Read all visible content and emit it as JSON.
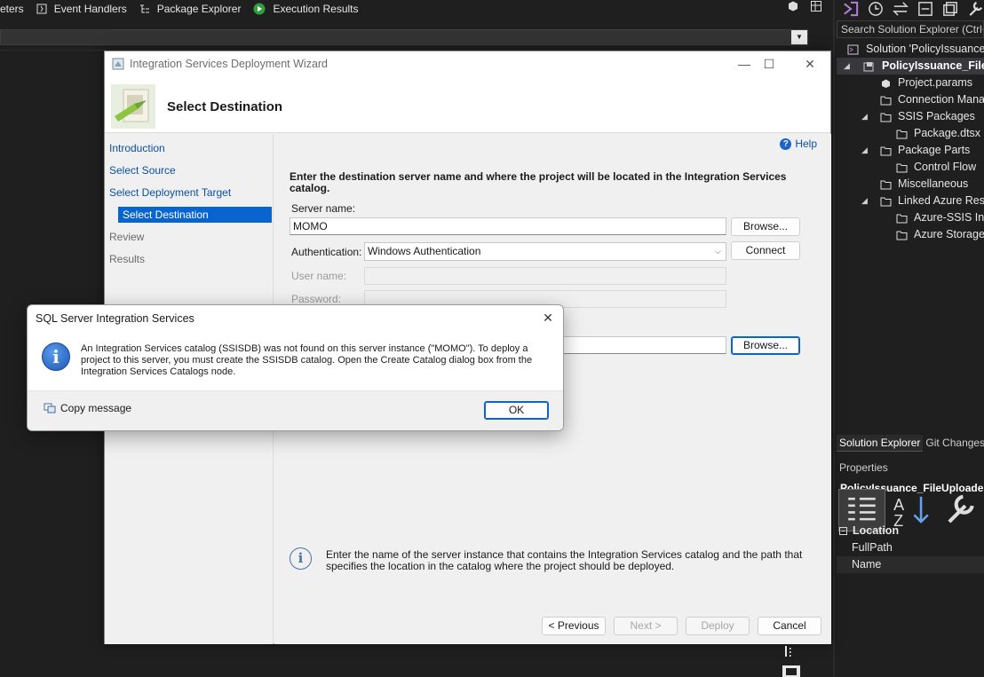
{
  "vs": {
    "toolbar": {
      "items": [
        {
          "label": "eters"
        },
        {
          "label": "Event Handlers"
        },
        {
          "label": "Package Explorer"
        },
        {
          "label": "Execution Results"
        }
      ]
    }
  },
  "solution_explorer": {
    "search_placeholder": "Search Solution Explorer (Ctrl+;)",
    "tree": [
      {
        "label": "Solution 'PolicyIssuance_FileUploader'",
        "depth": 0,
        "arrow": "",
        "icon": "solution-icon"
      },
      {
        "label": "PolicyIssuance_FileUploader",
        "depth": 0,
        "arrow": "expanded",
        "icon": "project-icon",
        "selected": true,
        "bold": true
      },
      {
        "label": "Project.params",
        "depth": 1,
        "arrow": "",
        "icon": "params-icon"
      },
      {
        "label": "Connection Managers",
        "depth": 1,
        "arrow": "",
        "icon": "folder-icon"
      },
      {
        "label": "SSIS Packages",
        "depth": 1,
        "arrow": "expanded",
        "icon": "folder-icon"
      },
      {
        "label": "Package.dtsx",
        "depth": 2,
        "arrow": "",
        "icon": "package-icon"
      },
      {
        "label": "Package Parts",
        "depth": 1,
        "arrow": "expanded",
        "icon": "folder-icon"
      },
      {
        "label": "Control Flow",
        "depth": 2,
        "arrow": "",
        "icon": "folder-icon"
      },
      {
        "label": "Miscellaneous",
        "depth": 1,
        "arrow": "",
        "icon": "folder-icon"
      },
      {
        "label": "Linked Azure Resources",
        "depth": 1,
        "arrow": "expanded",
        "icon": "folder-icon"
      },
      {
        "label": "Azure-SSIS Integration Runtime",
        "depth": 2,
        "arrow": "",
        "icon": "folder-icon"
      },
      {
        "label": "Azure Storage",
        "depth": 2,
        "arrow": "",
        "icon": "folder-icon"
      }
    ],
    "tabs": [
      {
        "label": "Solution Explorer",
        "active": true
      },
      {
        "label": "Git Changes",
        "active": false
      }
    ]
  },
  "properties": {
    "title": "Properties",
    "object": "PolicyIssuance_FileUploader",
    "category": "Location",
    "rows": [
      "FullPath",
      "Name"
    ]
  },
  "wizard": {
    "title": "Integration Services Deployment Wizard",
    "header": "Select Destination",
    "nav": [
      {
        "label": "Introduction",
        "state": "link"
      },
      {
        "label": "Select Source",
        "state": "link"
      },
      {
        "label": "Select Deployment Target",
        "state": "link"
      },
      {
        "label": "Select Destination",
        "state": "active"
      },
      {
        "label": "Review",
        "state": "grey"
      },
      {
        "label": "Results",
        "state": "grey"
      }
    ],
    "help": "Help",
    "instruction": "Enter the destination server name and where the project will be located in the Integration Services catalog.",
    "server_label": "Server name:",
    "server_value": "MOMO",
    "browse_label": "Browse...",
    "auth_label": "Authentication:",
    "auth_value": "Windows Authentication",
    "connect_label": "Connect",
    "user_label": "User name:",
    "password_label": "Password:",
    "path_browse_label": "Browse...",
    "info_text": "Enter the name of the server instance that contains the Integration Services catalog and the path that specifies the location in the catalog where the project should be deployed.",
    "buttons": {
      "previous": "< Previous",
      "next": "Next >",
      "deploy": "Deploy",
      "cancel": "Cancel"
    }
  },
  "message_box": {
    "title": "SQL Server Integration Services",
    "message": "An Integration Services catalog (SSISDB) was not found on this server instance (\"MOMO\"). To deploy a project to this server, you must create the SSISDB catalog. Open the Create Catalog dialog box from the Integration Services Catalogs node.",
    "copy_label": "Copy message",
    "ok_label": "OK"
  },
  "colors": {
    "accent": "#0a64d0",
    "link": "#0b4fa6",
    "vs_background": "#1f1f1f"
  }
}
